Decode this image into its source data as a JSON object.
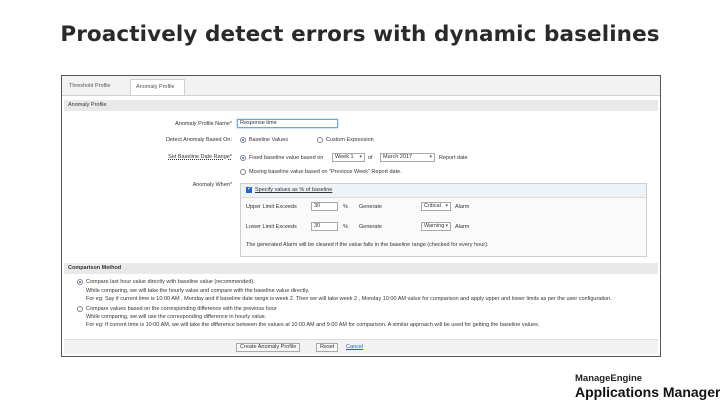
{
  "slide_title": "Proactively detect errors with dynamic baselines",
  "tabs": [
    {
      "label": "Threshold Profile"
    },
    {
      "label": "Anomaly Profile"
    }
  ],
  "anomaly_section": {
    "title": "Anomaly Profile",
    "profile_name_label": "Anomaly Profile Name*",
    "profile_name_value": "Response time",
    "detect_label": "Detect Anomaly Based On:",
    "detect_options": [
      {
        "label": "Baseline Values",
        "selected": true
      },
      {
        "label": "Custom Expression",
        "selected": false
      }
    ],
    "date_range_label": "Set Baseline Date Range*",
    "fixed_label": "Fixed baseline value based on",
    "week_select": "Week 1",
    "of_label": "of",
    "month_select": "March 2017",
    "report_date_label": "Report date",
    "moving_label": "Moving baseline value based on \"Previous Week\" Report date.",
    "anomaly_when_label": "Anomaly When*",
    "specify_label": "Specify values as % of baseline",
    "upper_label": "Upper Limit Exceeds",
    "upper_value": "30",
    "upper_pct": "%",
    "upper_generate": "Generate",
    "upper_severity": "Critical",
    "upper_alarm": "Alarm",
    "lower_label": "Lower Limit Exceeds",
    "lower_value": "30",
    "lower_pct": "%",
    "lower_generate": "Generate",
    "lower_severity": "Warning",
    "lower_alarm": "Alarm",
    "clear_note": "The generated Alarm will be cleared if the value falls in the baseline range (checked for every hour)."
  },
  "comparison_section": {
    "title": "Comparison Method",
    "option1_label": "Compare last hour value directly with baseline value (recommended).",
    "option1_desc1": "While comparing, we will take the hourly value and compare with the baseline value directly.",
    "option1_desc2": "For eg: Say if current time is 10:00 AM , Monday and if baseline date range is week 2. Then we will take week 2 , Monday 10:00 AM value for comparison and apply upper and lower limits as per the user configuration.",
    "option2_label": "Compare values based on the corresponding difference with the previous hour",
    "option2_desc1": "While comparing, we will use the corresponding difference in hourly value.",
    "option2_desc2": "For eg: If current time is 10:00 AM, we will take the difference between the values at 10:00 AM and 9:00 AM for comparison. A similar approach will be used for getting the baseline values."
  },
  "footer": {
    "create_button": "Create Anomaly Profile",
    "reset_button": "Reset",
    "cancel_link": "Cancel"
  },
  "branding": {
    "company": "ManageEngine",
    "product": "Applications Manager"
  },
  "colors": {
    "accent": "#2a62c9",
    "focus": "#6ea7df"
  }
}
